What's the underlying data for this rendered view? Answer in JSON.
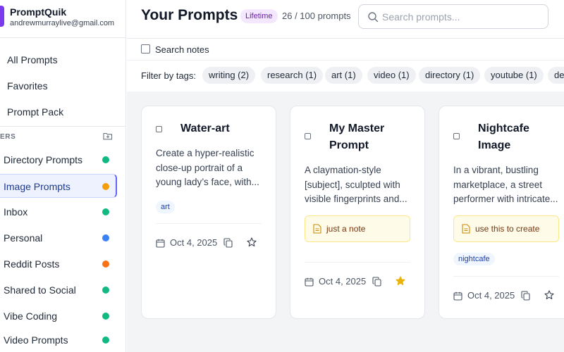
{
  "brand": {
    "name": "PromptQuik",
    "email": "andrewmurraylive@gmail.com"
  },
  "nav": {
    "all_prompts": "All Prompts",
    "favorites": "Favorites",
    "prompt_pack": "Prompt Pack"
  },
  "folders_header": "ERS",
  "folders": [
    {
      "label": "Directory Prompts",
      "color": "#10b981"
    },
    {
      "label": "Image Prompts",
      "color": "#f59e0b"
    },
    {
      "label": "Inbox",
      "color": "#10b981"
    },
    {
      "label": "Personal",
      "color": "#3b82f6"
    },
    {
      "label": "Reddit Posts",
      "color": "#f97316"
    },
    {
      "label": "Shared to Social",
      "color": "#10b981"
    },
    {
      "label": "Vibe Coding",
      "color": "#10b981"
    },
    {
      "label": "Video Prompts",
      "color": "#10b981"
    }
  ],
  "header": {
    "title": "Your Prompts",
    "plan_badge": "Lifetime",
    "usage": "26 / 100 prompts",
    "search_placeholder": "Search prompts..."
  },
  "search_notes_label": "Search notes",
  "tags_label": "Filter by tags:",
  "tags": [
    "writing (2)",
    "research (1)",
    "art (1)",
    "video (1)",
    "directory (1)",
    "youtube (1)",
    "de"
  ],
  "cards": [
    {
      "title": "Water-art",
      "body": "Create a hyper-realistic close-up portrait of a young lady’s face, with...",
      "tag": "art",
      "date": "Oct 4, 2025",
      "favorite": false
    },
    {
      "title": "My Master Prompt",
      "body": "A claymation-style [subject], sculpted with visible fingerprints and...",
      "note": "just a note",
      "date": "Oct 4, 2025",
      "favorite": true
    },
    {
      "title": "Nightcafe Image",
      "body": "In a vibrant, bustling marketplace, a street performer with intricate...",
      "note": "use this to create",
      "tag": "nightcafe",
      "date": "Oct 4, 2025",
      "favorite": false
    }
  ],
  "colors": {
    "accent": "#7c3aed",
    "active_folder_bg": "#eef2ff",
    "favorite_star": "#eab308"
  }
}
